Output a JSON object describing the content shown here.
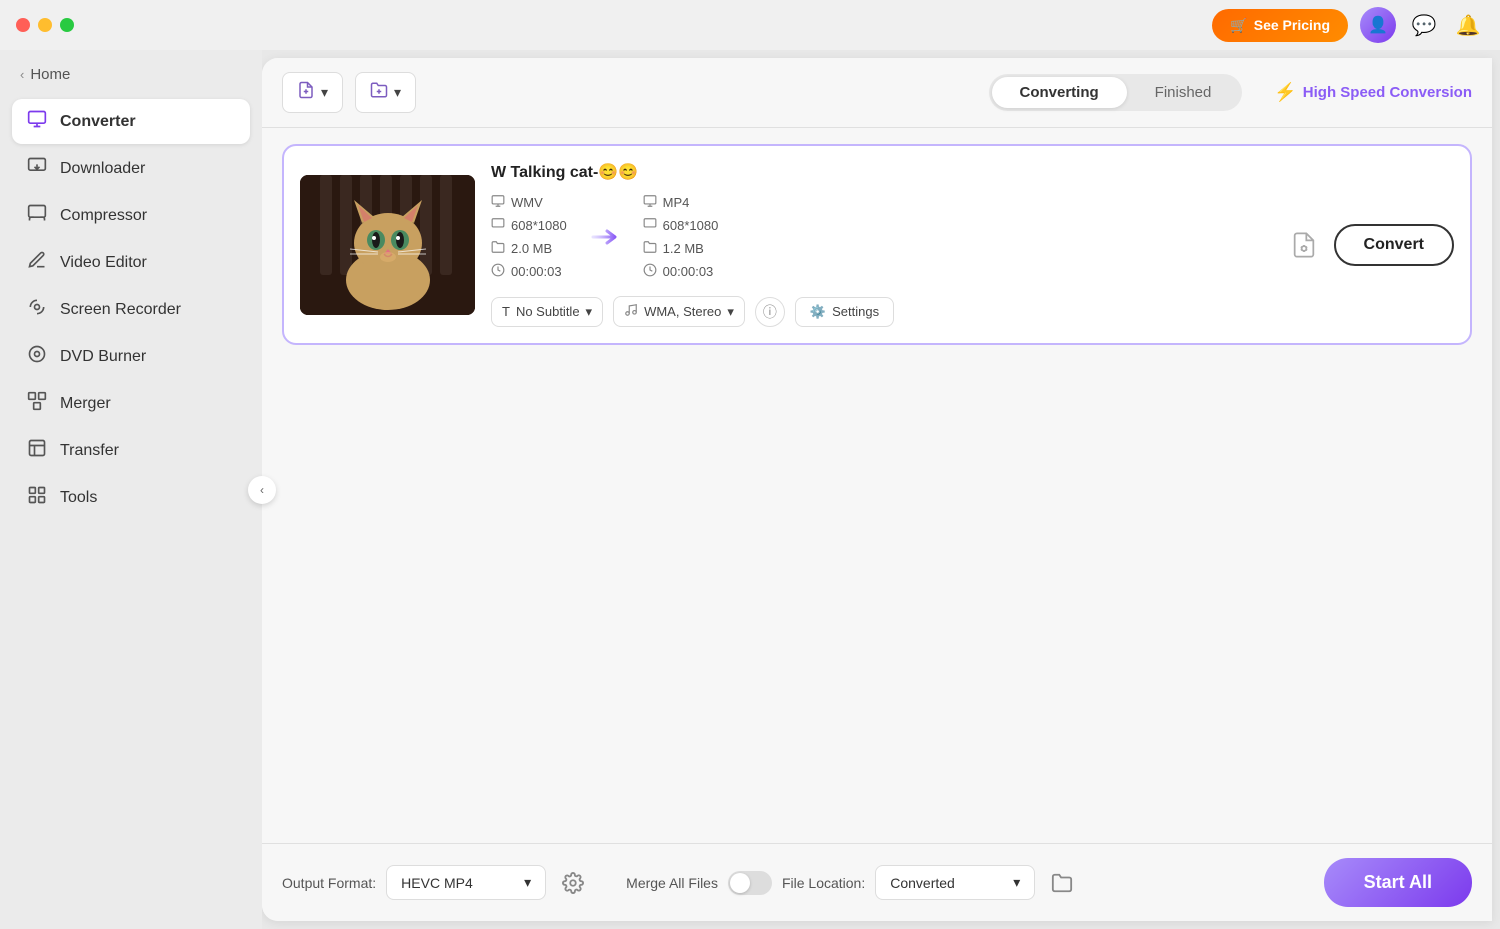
{
  "titleBar": {
    "seePricing": "See Pricing",
    "cartIcon": "🛒"
  },
  "sidebar": {
    "homeLabel": "Home",
    "items": [
      {
        "id": "converter",
        "label": "Converter",
        "icon": "🖼️",
        "active": true
      },
      {
        "id": "downloader",
        "label": "Downloader",
        "icon": "⬇️",
        "active": false
      },
      {
        "id": "compressor",
        "label": "Compressor",
        "icon": "🗜️",
        "active": false
      },
      {
        "id": "video-editor",
        "label": "Video Editor",
        "icon": "✂️",
        "active": false
      },
      {
        "id": "screen-recorder",
        "label": "Screen Recorder",
        "icon": "📷",
        "active": false
      },
      {
        "id": "dvd-burner",
        "label": "DVD Burner",
        "icon": "💿",
        "active": false
      },
      {
        "id": "merger",
        "label": "Merger",
        "icon": "🔗",
        "active": false
      },
      {
        "id": "transfer",
        "label": "Transfer",
        "icon": "📋",
        "active": false
      },
      {
        "id": "tools",
        "label": "Tools",
        "icon": "🧰",
        "active": false
      }
    ]
  },
  "toolbar": {
    "addFileLabel": "",
    "addFolderLabel": "",
    "tabs": [
      {
        "id": "converting",
        "label": "Converting",
        "active": true
      },
      {
        "id": "finished",
        "label": "Finished",
        "active": false
      }
    ],
    "highSpeedLabel": "High Speed Conversion"
  },
  "fileCard": {
    "title": "W Talking cat-😊😊",
    "source": {
      "format": "WMV",
      "resolution": "608*1080",
      "size": "2.0 MB",
      "duration": "00:00:03"
    },
    "target": {
      "format": "MP4",
      "resolution": "608*1080",
      "size": "1.2 MB",
      "duration": "00:00:03"
    },
    "subtitle": "No Subtitle",
    "audio": "WMA, Stereo",
    "settingsLabel": "Settings",
    "convertLabel": "Convert"
  },
  "bottomBar": {
    "outputFormatLabel": "Output Format:",
    "outputFormatValue": "HEVC MP4",
    "fileLocationLabel": "File Location:",
    "fileLocationValue": "Converted",
    "mergeLabel": "Merge All Files",
    "startLabel": "Start All"
  }
}
